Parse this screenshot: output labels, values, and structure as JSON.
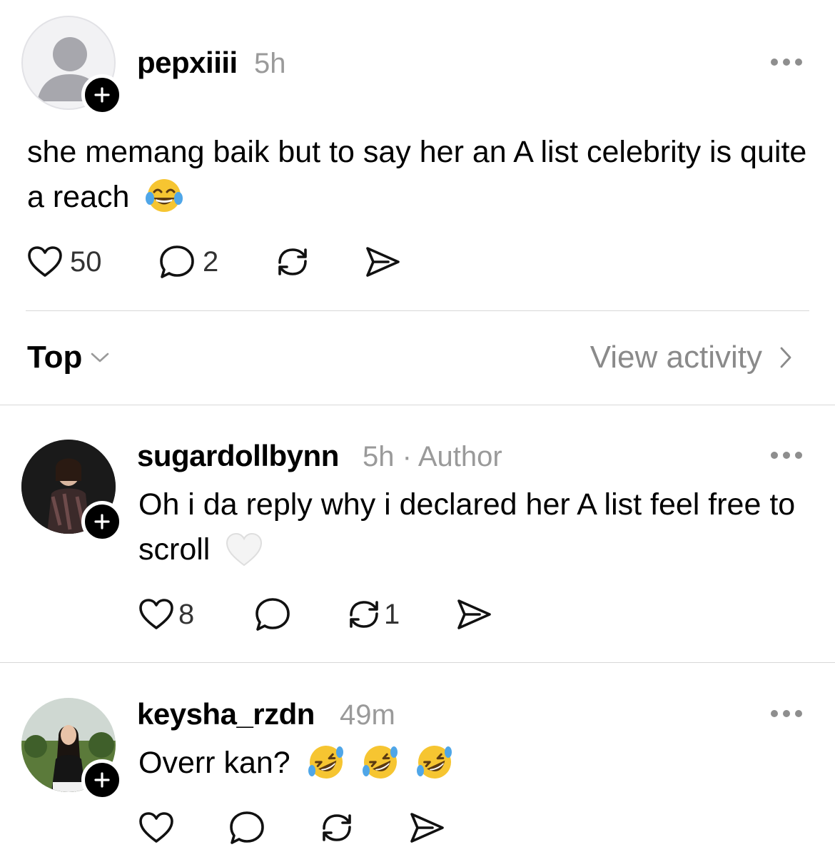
{
  "post": {
    "username": "pepxiiii",
    "time": "5h",
    "text": "she memang baik but to say her an A list celebrity is quite a reach",
    "emoji": "face-with-tears-of-joy",
    "likes": "50",
    "replies": "2",
    "avatar_icon": "default-person-icon"
  },
  "sort": {
    "label": "Top",
    "view_activity": "View activity"
  },
  "replies": [
    {
      "username": "sugardollbynn",
      "time": "5h",
      "separator": "·",
      "badge": "Author",
      "text": "Oh i da reply why i declared her A list feel free to scroll",
      "emoji": "white-heart",
      "likes": "8",
      "reposts": "1"
    },
    {
      "username": "keysha_rzdn",
      "time": "49m",
      "text": "Overr kan?",
      "emoji": "rolling-on-the-floor-laughing x3"
    }
  ],
  "colors": {
    "text": "#000000",
    "muted": "#9a9a9a",
    "divider": "#d8d8d8",
    "badge": "#000000"
  }
}
